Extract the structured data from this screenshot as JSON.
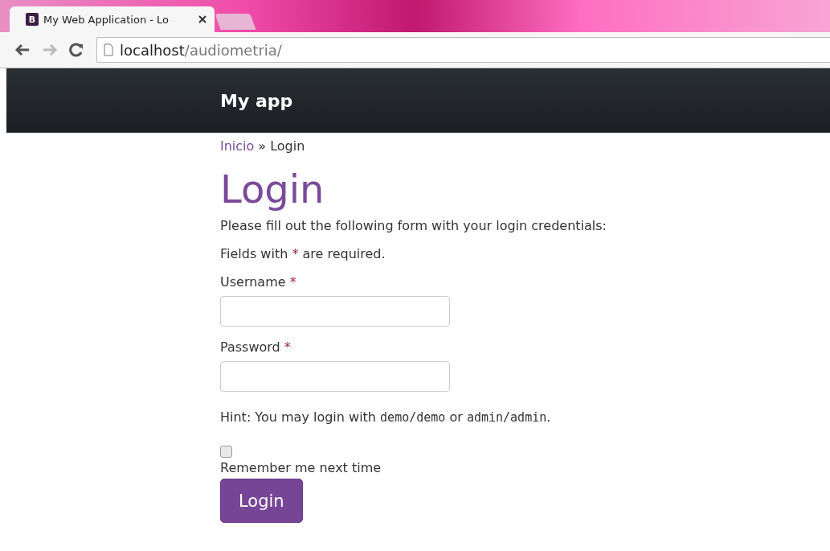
{
  "browser": {
    "tab": {
      "favicon": "B",
      "title": "My Web Application - Lo",
      "selected": true
    },
    "address": {
      "host": "localhost",
      "path": "/audiometria/"
    }
  },
  "navbar": {
    "brand": "My app"
  },
  "breadcrumbs": [
    {
      "label": "Inicio",
      "kind": "link"
    },
    {
      "label": "»",
      "kind": "separator"
    },
    {
      "label": "Login",
      "kind": "current"
    }
  ],
  "heading": "Login",
  "intro": "Please fill out the following form with your login credentials:",
  "note": [
    {
      "kind": "text",
      "text": "Fields with "
    },
    {
      "kind": "mark",
      "text": "*"
    },
    {
      "kind": "text",
      "text": " are required."
    }
  ],
  "fields": [
    {
      "label": "Username",
      "required_mark": "*"
    },
    {
      "label": "Password",
      "required_mark": "*"
    }
  ],
  "hint": [
    {
      "kind": "text",
      "text": "Hint: You may login with "
    },
    {
      "kind": "code",
      "text": "demo/demo"
    },
    {
      "kind": "text",
      "text": " or "
    },
    {
      "kind": "code",
      "text": "admin/admin"
    },
    {
      "kind": "text",
      "text": "."
    }
  ],
  "remember": {
    "label": "Remember me next time",
    "checked": false
  },
  "submit": "Login"
}
